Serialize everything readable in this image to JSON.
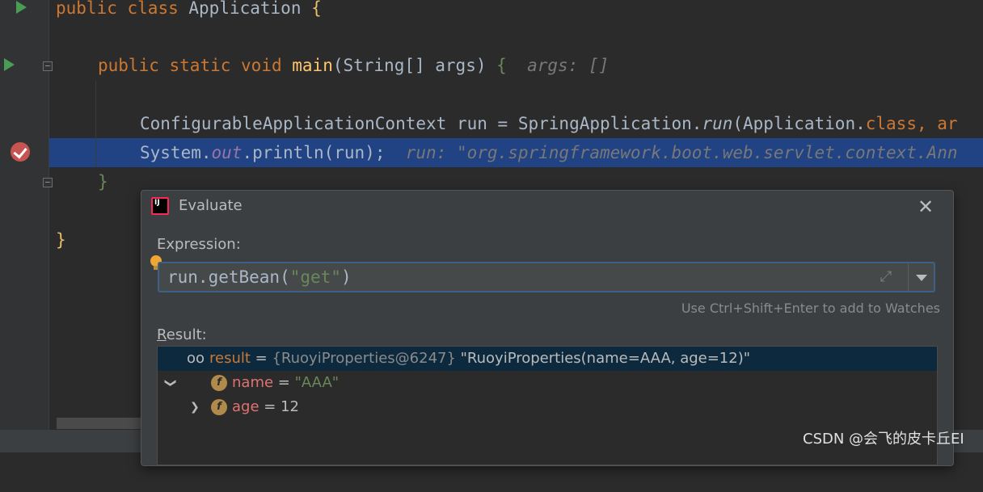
{
  "editor": {
    "class_line": {
      "kw1": "public",
      "kw2": "class",
      "name": "Application",
      "brace": "{"
    },
    "main_line": {
      "kw1": "public",
      "kw2": "static",
      "kw3": "void",
      "fn": "main",
      "params": "(String[] args)",
      "brace": "{",
      "hint": "args: []"
    },
    "context_line": {
      "type": "ConfigurableApplicationContext",
      "var": "run",
      "eq": "=",
      "cls": "SpringApplication.",
      "method": "run",
      "args": "(Application.",
      "kw": "class",
      "tail": ", ar"
    },
    "print_line": {
      "cls": "System.",
      "field": "out",
      "call": ".println(run);",
      "hint": "run: \"org.springframework.boot.web.servlet.context.Ann"
    },
    "method_close": "}",
    "class_close": "}"
  },
  "dialog": {
    "title": "Evaluate",
    "logo_text": "IJ",
    "close": "✕",
    "expression_label": "Expression:",
    "expression": {
      "pre": "run.getBean(",
      "str": "\"get\"",
      "post": ")"
    },
    "watch_hint": "Use Ctrl+Shift+Enter to add to Watches",
    "result_label": {
      "first": "R",
      "rest": "esult:"
    },
    "result": {
      "root": {
        "name": "result",
        "eq": " = ",
        "type": "{RuoyiProperties@6247}",
        "value": " \"RuoyiProperties(name=AAA, age=12)\""
      },
      "children": [
        {
          "icon": "f",
          "name": "name",
          "eq": " = ",
          "value": "\"AAA\""
        },
        {
          "icon": "f",
          "name": "age",
          "eq": " = ",
          "value": "12"
        }
      ]
    }
  },
  "watermark": "CSDN @会飞的皮卡丘EI"
}
